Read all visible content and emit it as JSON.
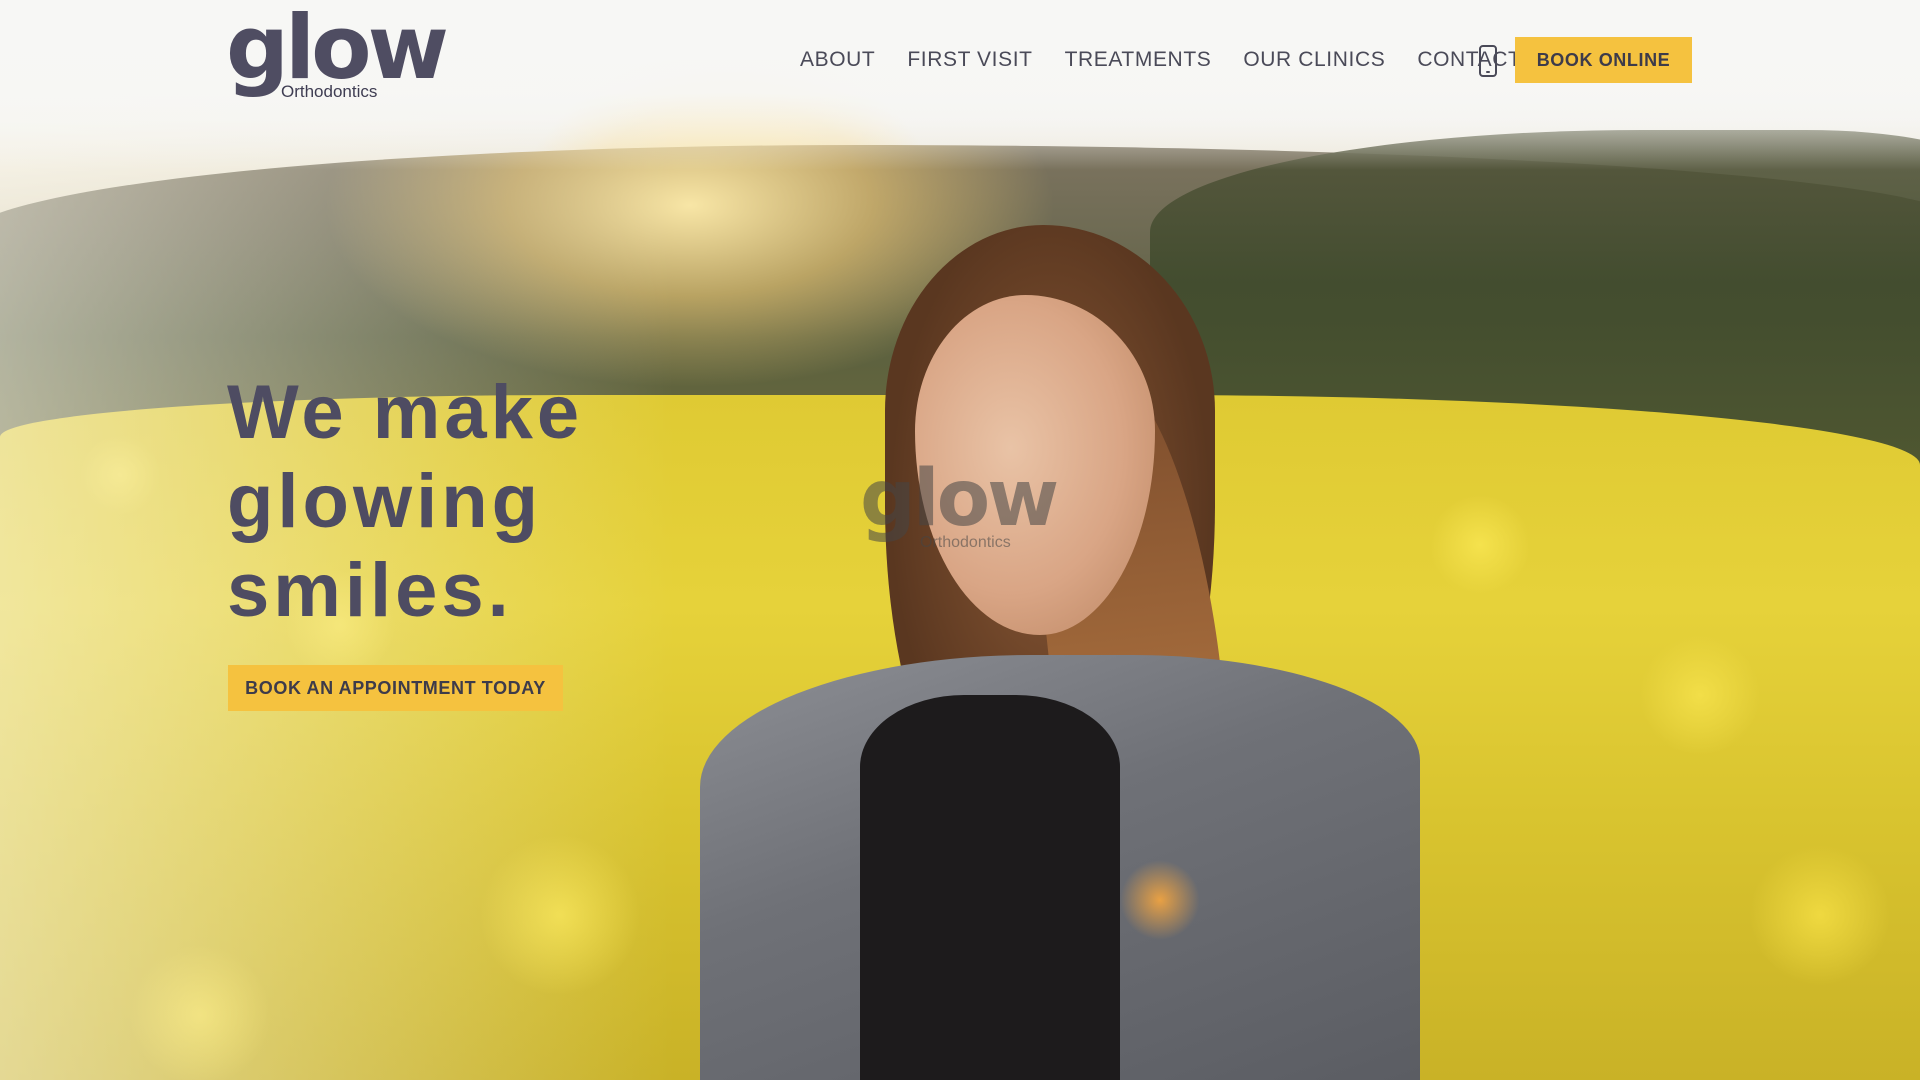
{
  "brand": {
    "name": "glow",
    "subtitle": "Orthodontics"
  },
  "nav": {
    "items": [
      "ABOUT",
      "FIRST VISIT",
      "TREATMENTS",
      "OUR CLINICS",
      "CONTACT"
    ],
    "phone_icon": "phone-icon",
    "book_online_label": "BOOK ONLINE"
  },
  "hero": {
    "headline_lines": [
      "We make",
      "glowing",
      "smiles."
    ],
    "cta_label": "BOOK AN APPOINTMENT TODAY",
    "watermark": {
      "name": "glow",
      "subtitle": "Orthodontics"
    }
  },
  "colors": {
    "accent": "#f5c23f",
    "text_dark": "#4e4c62"
  }
}
